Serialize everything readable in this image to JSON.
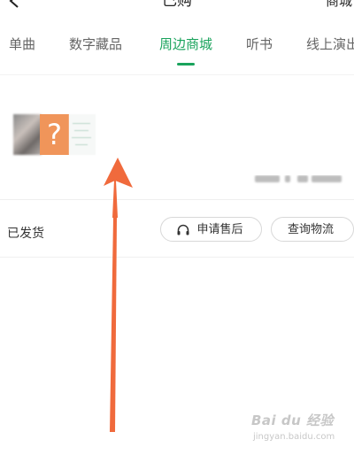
{
  "header": {
    "back_icon": "arrow-left-icon",
    "title": "已购",
    "right_label": "商城"
  },
  "tabs": [
    {
      "label": "单曲",
      "active": false
    },
    {
      "label": "数字藏品",
      "active": false
    },
    {
      "label": "周边商城",
      "active": true
    },
    {
      "label": "听书",
      "active": false
    },
    {
      "label": "线上演出",
      "active": false
    }
  ],
  "order": {
    "thumb_placeholder": "?",
    "status": "已发货",
    "actions": {
      "after_sale": "申请售后",
      "after_sale_icon": "headset-icon",
      "logistics": "查询物流"
    }
  },
  "watermark": {
    "brand": "Bai du 经验",
    "url": "jingyan.baidu.com"
  },
  "colors": {
    "accent": "#1aa35c",
    "arrow": "#f06a3c",
    "placeholder_bg": "#f0955a"
  }
}
